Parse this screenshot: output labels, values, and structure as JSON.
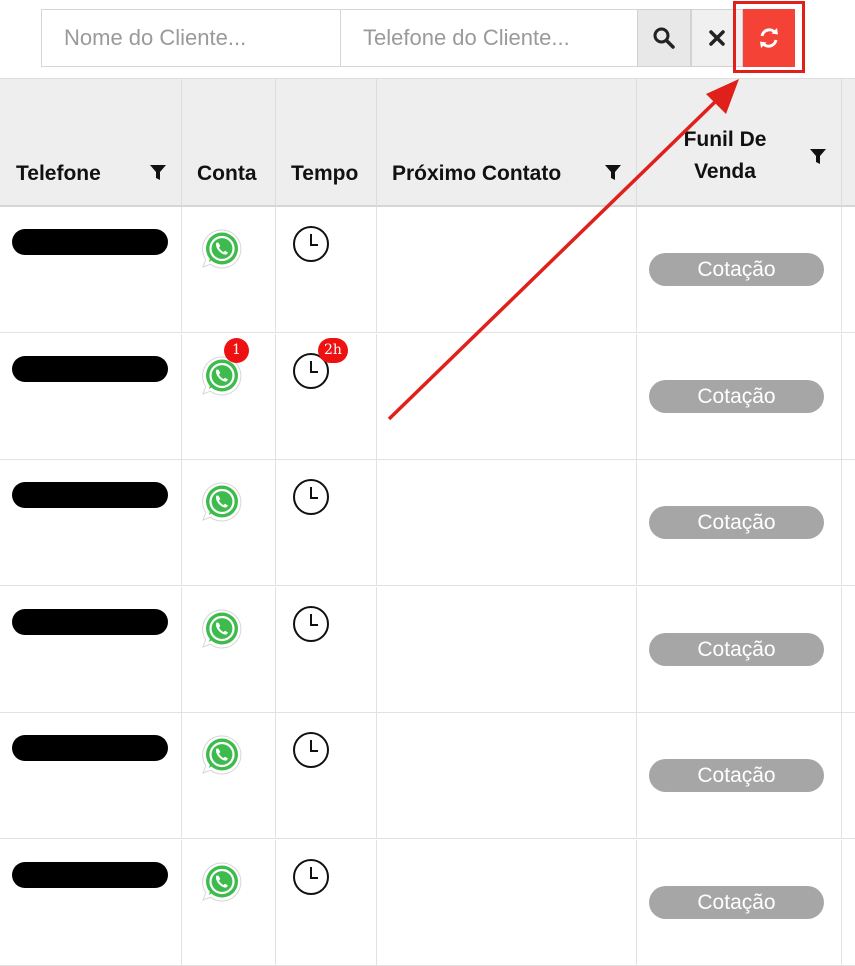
{
  "search": {
    "name_placeholder": "Nome do Cliente...",
    "phone_placeholder": "Telefone do Cliente..."
  },
  "buttons": {
    "search_icon": "search-icon",
    "clear_icon": "close-icon",
    "refresh_icon": "refresh-icon",
    "refresh_color": "#f44336"
  },
  "table": {
    "headers": {
      "telefone": "Telefone",
      "conta": "Conta",
      "tempo": "Tempo",
      "proximo_contato": "Próximo Contato",
      "funil_line1": "Funil De",
      "funil_line2": "Venda"
    },
    "rows": [
      {
        "stage": "Cotação",
        "conta_badge": "",
        "tempo_badge": ""
      },
      {
        "stage": "Cotação",
        "conta_badge": "1",
        "tempo_badge": "2h"
      },
      {
        "stage": "Cotação",
        "conta_badge": "",
        "tempo_badge": ""
      },
      {
        "stage": "Cotação",
        "conta_badge": "",
        "tempo_badge": ""
      },
      {
        "stage": "Cotação",
        "conta_badge": "",
        "tempo_badge": ""
      },
      {
        "stage": "Cotação",
        "conta_badge": "",
        "tempo_badge": ""
      }
    ]
  },
  "annotation": {
    "color": "#e0201b"
  }
}
